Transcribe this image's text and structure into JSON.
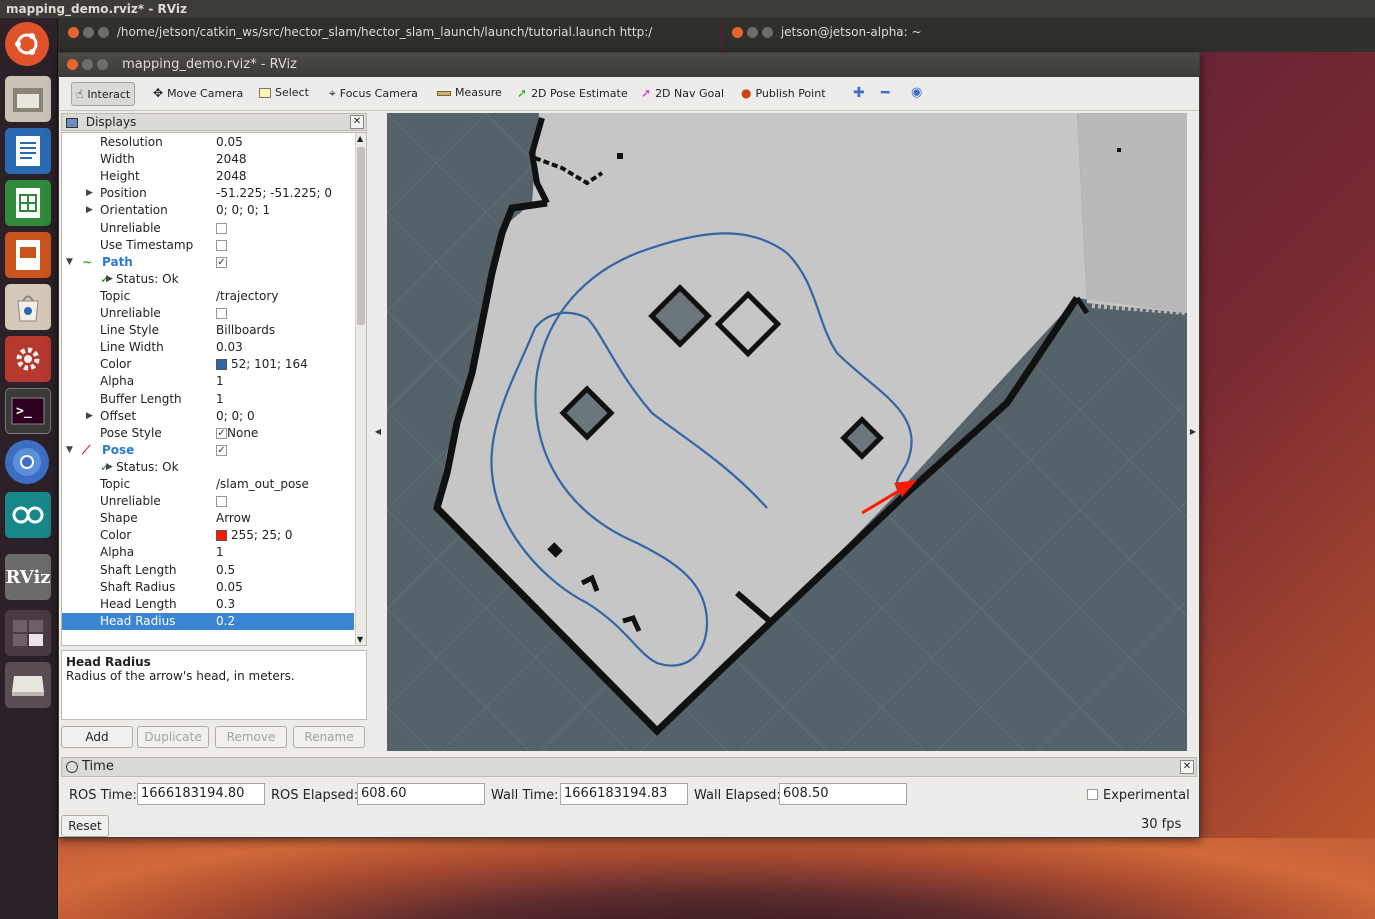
{
  "system": {
    "active_title": "mapping_demo.rviz* - RViz"
  },
  "background_windows": {
    "terminal1_title": "/home/jetson/catkin_ws/src/hector_slam/hector_slam_launch/launch/tutorial.launch http:/",
    "terminal2_title": "jetson@jetson-alpha: ~"
  },
  "launcher": {
    "items": [
      {
        "icon": "ubuntu-dash-icon"
      },
      {
        "icon": "files-icon"
      },
      {
        "icon": "writer-icon"
      },
      {
        "icon": "calc-icon"
      },
      {
        "icon": "impress-icon"
      },
      {
        "icon": "software-center-icon"
      },
      {
        "icon": "system-settings-icon"
      },
      {
        "icon": "terminal-icon"
      },
      {
        "icon": "chromium-icon"
      },
      {
        "icon": "arduino-icon"
      },
      {
        "icon": "rviz-icon",
        "label": "RViz"
      },
      {
        "icon": "workspace-switcher-icon"
      },
      {
        "icon": "drive-icon"
      }
    ]
  },
  "window": {
    "title": "mapping_demo.rviz* - RViz"
  },
  "toolbar": {
    "interact": "Interact",
    "move_camera": "Move Camera",
    "select": "Select",
    "focus_camera": "Focus Camera",
    "measure": "Measure",
    "pose_estimate": "2D Pose Estimate",
    "nav_goal": "2D Nav Goal",
    "publish_point": "Publish Point"
  },
  "displays": {
    "title": "Displays",
    "rows": [
      {
        "key": "Resolution",
        "value": "0.05"
      },
      {
        "key": "Width",
        "value": "2048"
      },
      {
        "key": "Height",
        "value": "2048"
      },
      {
        "key": "Position",
        "value": "-51.225; -51.225; 0"
      },
      {
        "key": "Orientation",
        "value": "0; 0; 0; 1"
      },
      {
        "key": "Unreliable",
        "value": ""
      },
      {
        "key": "Use Timestamp",
        "value": ""
      },
      {
        "key": "Path",
        "value": ""
      },
      {
        "key": "Status: Ok",
        "value": ""
      },
      {
        "key": "Topic",
        "value": "/trajectory"
      },
      {
        "key": "Unreliable",
        "value": ""
      },
      {
        "key": "Line Style",
        "value": "Billboards"
      },
      {
        "key": "Line Width",
        "value": "0.03"
      },
      {
        "key": "Color",
        "value": "52; 101; 164"
      },
      {
        "key": "Alpha",
        "value": "1"
      },
      {
        "key": "Buffer Length",
        "value": "1"
      },
      {
        "key": "Offset",
        "value": "0; 0; 0"
      },
      {
        "key": "Pose Style",
        "value": "None"
      },
      {
        "key": "Pose",
        "value": ""
      },
      {
        "key": "Status: Ok",
        "value": ""
      },
      {
        "key": "Topic",
        "value": "/slam_out_pose"
      },
      {
        "key": "Unreliable",
        "value": ""
      },
      {
        "key": "Shape",
        "value": "Arrow"
      },
      {
        "key": "Color",
        "value": "255; 25; 0"
      },
      {
        "key": "Alpha",
        "value": "1"
      },
      {
        "key": "Shaft Length",
        "value": "0.5"
      },
      {
        "key": "Shaft Radius",
        "value": "0.05"
      },
      {
        "key": "Head Length",
        "value": "0.3"
      },
      {
        "key": "Head Radius",
        "value": "0.2"
      }
    ],
    "path_color": "#3465a4",
    "pose_color": "#ff1900",
    "description_title": "Head Radius",
    "description_text": "Radius of the arrow's head, in meters.",
    "buttons": {
      "add": "Add",
      "duplicate": "Duplicate",
      "remove": "Remove",
      "rename": "Rename"
    }
  },
  "time": {
    "title": "Time",
    "ros_time_label": "ROS Time:",
    "ros_time": "1666183194.80",
    "ros_elapsed_label": "ROS Elapsed:",
    "ros_elapsed": "608.60",
    "wall_time_label": "Wall Time:",
    "wall_time": "1666183194.83",
    "wall_elapsed_label": "Wall Elapsed:",
    "wall_elapsed": "608.50",
    "experimental_label": "Experimental",
    "reset": "Reset",
    "fps": "30 fps"
  }
}
